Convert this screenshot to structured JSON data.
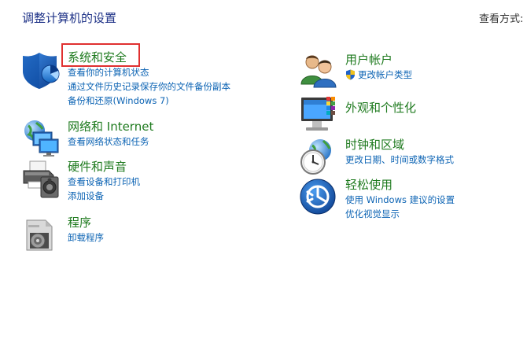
{
  "header": {
    "title": "调整计算机的设置",
    "view_by": "查看方式:"
  },
  "left_categories": [
    {
      "icon": "shield-icon",
      "title": "系统和安全",
      "links": [
        "查看你的计算机状态",
        "通过文件历史记录保存你的文件备份副本",
        "备份和还原(Windows 7)"
      ]
    },
    {
      "icon": "network-icon",
      "title": "网络和 Internet",
      "links": [
        "查看网络状态和任务"
      ]
    },
    {
      "icon": "printer-icon",
      "title": "硬件和声音",
      "links": [
        "查看设备和打印机",
        "添加设备"
      ]
    },
    {
      "icon": "programs-icon",
      "title": "程序",
      "links": [
        "卸载程序"
      ]
    }
  ],
  "right_categories": [
    {
      "icon": "users-icon",
      "title": "用户帐户",
      "links": [
        "更改帐户类型"
      ]
    },
    {
      "icon": "appearance-icon",
      "title": "外观和个性化",
      "links": []
    },
    {
      "icon": "clock-icon",
      "title": "时钟和区域",
      "links": [
        "更改日期、时间或数字格式"
      ]
    },
    {
      "icon": "accessibility-icon",
      "title": "轻松使用",
      "links": [
        "使用 Windows 建议的设置",
        "优化视觉显示"
      ]
    }
  ],
  "colors": {
    "title_blue": "#1e3287",
    "category_green": "#1e7a1e",
    "link_blue": "#0d64b4",
    "highlight_red": "#e03030"
  }
}
